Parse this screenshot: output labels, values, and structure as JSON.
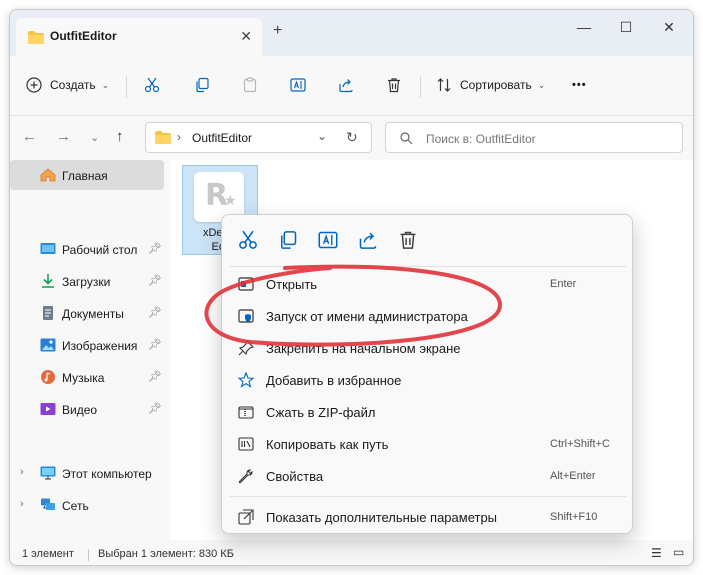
{
  "window": {
    "tab_title": "OutfitEditor",
    "new_tab": "+",
    "controls": {
      "minimize": "—",
      "maximize": "☐",
      "close": "✕"
    }
  },
  "toolbar": {
    "create_label": "Создать",
    "sort_label": "Сортировать",
    "more_label": "•••"
  },
  "address": {
    "path_item": "OutfitEditor",
    "search_placeholder": "Поиск в: OutfitEditor"
  },
  "sidebar": {
    "home": "Главная",
    "items": [
      {
        "label": "Рабочий стол",
        "icon": "desktop-icon"
      },
      {
        "label": "Загрузки",
        "icon": "downloads-icon"
      },
      {
        "label": "Документы",
        "icon": "documents-icon"
      },
      {
        "label": "Изображения",
        "icon": "pictures-icon"
      },
      {
        "label": "Музыка",
        "icon": "music-icon"
      },
      {
        "label": "Видео",
        "icon": "video-icon"
      }
    ],
    "this_pc": "Этот компьютер",
    "network": "Сеть"
  },
  "content": {
    "file_name_line1": "xDev C",
    "file_name_line2": "Edit"
  },
  "status": {
    "count": "1 элемент",
    "selection": "Выбран 1 элемент: 830 КБ"
  },
  "context_menu": {
    "items": [
      {
        "label": "Открыть",
        "shortcut": "Enter"
      },
      {
        "label": "Запуск от имени администратора",
        "shortcut": ""
      },
      {
        "label": "Закрепить на начальном экране",
        "shortcut": ""
      },
      {
        "label": "Добавить в избранное",
        "shortcut": ""
      },
      {
        "label": "Сжать в ZIP-файл",
        "shortcut": ""
      },
      {
        "label": "Копировать как путь",
        "shortcut": "Ctrl+Shift+C"
      },
      {
        "label": "Свойства",
        "shortcut": "Alt+Enter"
      },
      {
        "label": "Показать дополнительные параметры",
        "shortcut": "Shift+F10"
      }
    ]
  },
  "colors": {
    "accent": "#0067c0",
    "annotation": "#e0323a",
    "selection": "#cce4f7"
  }
}
